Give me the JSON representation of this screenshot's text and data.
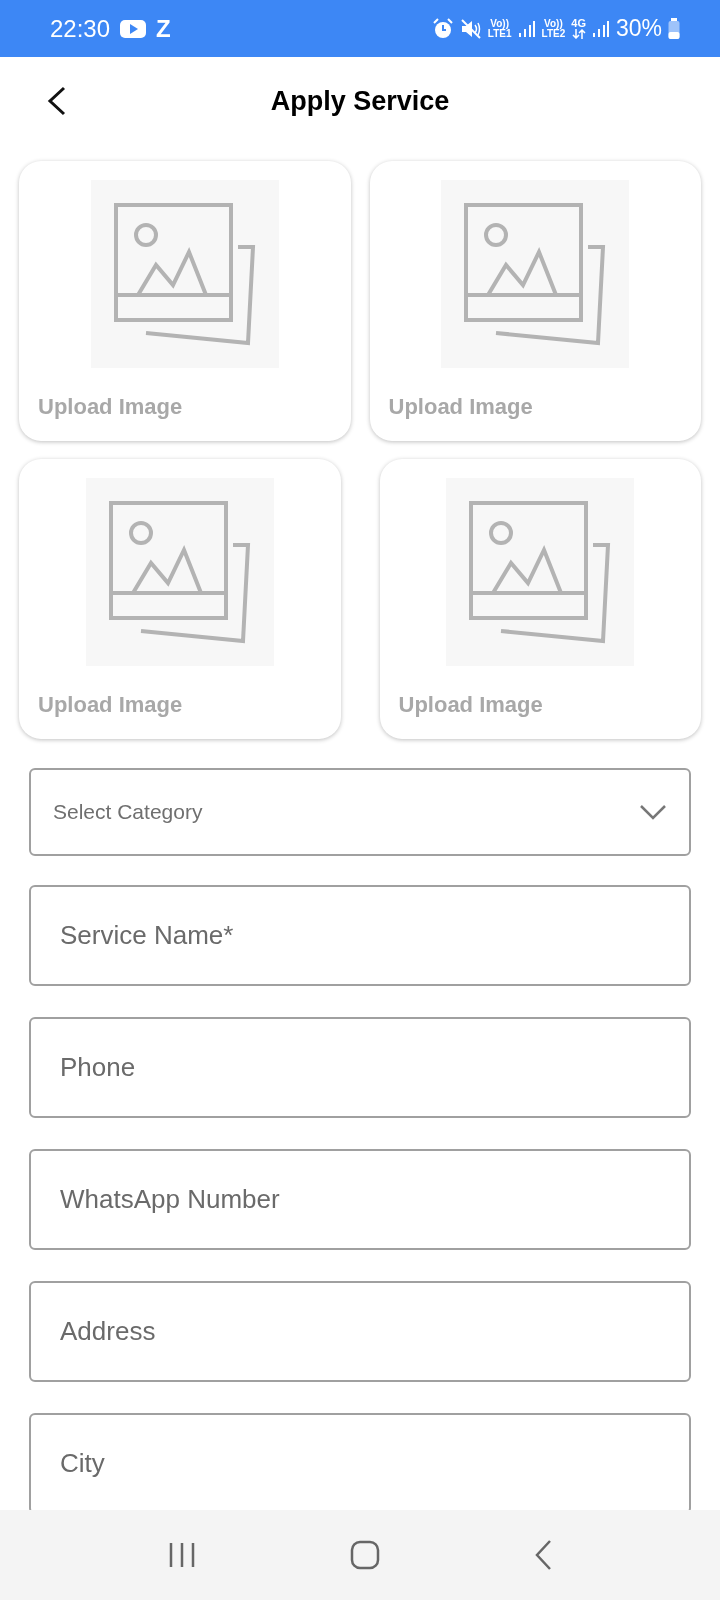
{
  "status_bar": {
    "time": "22:30",
    "app_letter": "Z",
    "sim1_volte": "Vo))",
    "sim1_label": "LTE1",
    "sim2_volte": "Vo))",
    "sim2_label": "LTE2",
    "network": "4G",
    "battery": "30%"
  },
  "header": {
    "title": "Apply Service"
  },
  "image_slots": [
    {
      "label": "Upload Image"
    },
    {
      "label": "Upload Image"
    },
    {
      "label": "Upload Image"
    },
    {
      "label": "Upload Image"
    }
  ],
  "category_select": {
    "placeholder": "Select Category"
  },
  "fields": [
    {
      "placeholder": "Service Name*"
    },
    {
      "placeholder": "Phone"
    },
    {
      "placeholder": "WhatsApp Number"
    },
    {
      "placeholder": "Address"
    },
    {
      "placeholder": "City"
    }
  ]
}
